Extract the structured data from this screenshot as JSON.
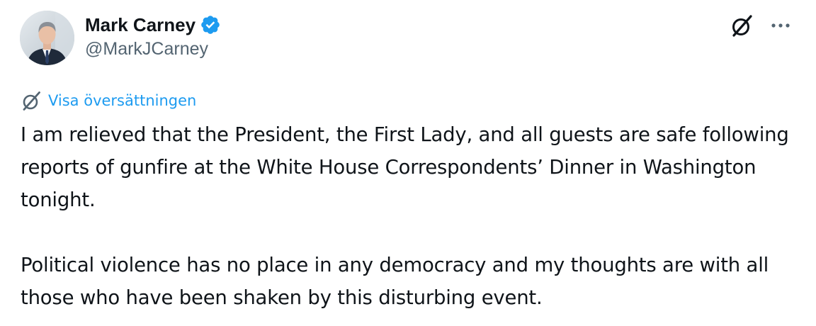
{
  "author": {
    "display_name": "Mark Carney",
    "handle": "@MarkJCarney",
    "verified": true,
    "verified_color": "#1d9bf0"
  },
  "actions": {
    "grok_icon": "grok-icon",
    "more_icon": "more-horizontal-icon"
  },
  "translate": {
    "icon": "grok-icon",
    "label": "Visa översättningen",
    "color": "#1d9bf0"
  },
  "tweet": {
    "paragraphs": [
      "I am relieved that the President, the First Lady, and all guests are safe following reports of gunfire at the White House Correspondents’ Dinner in Washington tonight.",
      "Political violence has no place in any democracy and my thoughts are with all those who have been shaken by this disturbing event."
    ]
  }
}
